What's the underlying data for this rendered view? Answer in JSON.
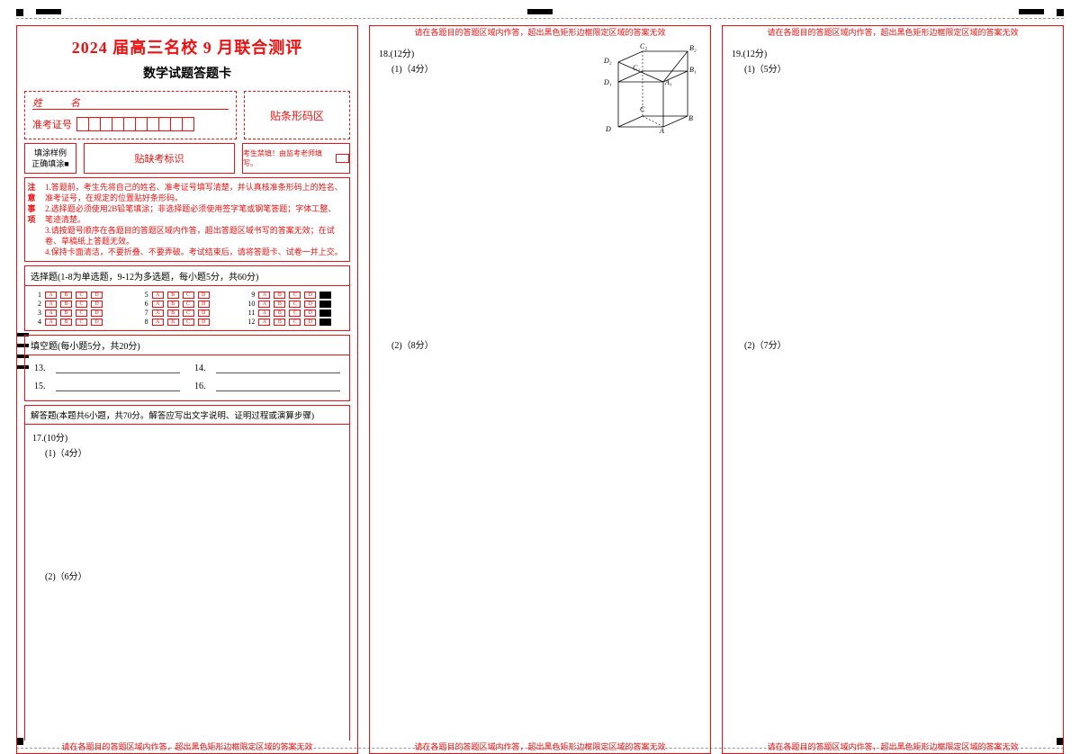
{
  "title": "2024 届高三名校 9 月联合测评",
  "subtitle": "数学试题答题卡",
  "name_label": "姓　名",
  "id_label": "准考证号",
  "barcode_area": "贴条形码区",
  "fill_example_title": "填涂样例",
  "fill_example_sub": "正确填涂■",
  "absent_mark_label": "贴缺考标识",
  "invigilator_sign": "考生禁填！由监考老师填写。",
  "notice_head": [
    "注",
    "意",
    "事",
    "项"
  ],
  "notice_lines": [
    "1.答题前，考生先将自己的姓名、准考证号填写清楚，并认真核准条形码上的姓名、准考证号，在规定的位置贴好条形码。",
    "2.选择题必须使用2B铅笔填涂；非选择题必须使用签字笔或钢笔答题；字体工整、笔迹清楚。",
    "3.请按题号顺序在各题目的答题区域内作答，超出答题区域书写的答案无效；在试卷、草稿纸上答题无效。",
    "4.保持卡面清洁，不要折叠、不要弄破。考试结束后，请将答题卡、试卷一并上交。"
  ],
  "mc_header": "选择题(1-8为单选题，9-12为多选题，每小题5分，共60分)",
  "mc_options": [
    "A",
    "B",
    "C",
    "D"
  ],
  "fillin_header": "填空题(每小题5分，共20分)",
  "fillin_nums": [
    "13.",
    "14.",
    "15.",
    "16."
  ],
  "free_header": "解答题(本题共6小题，共70分。解答应写出文字说明、证明过程或演算步骤)",
  "q17": {
    "hdr": "17.(10分)",
    "p1": "(1)（4分）",
    "p2": "(2)（6分）"
  },
  "warn_text": "请在各题目的答题区域内作答，超出黑色矩形边框限定区域的答案无效",
  "q18": {
    "hdr": "18.(12分)",
    "p1": "(1)（4分）",
    "p2": "(2)（8分）"
  },
  "q19": {
    "hdr": "19.(12分)",
    "p1": "(1)（5分）",
    "p2": "(2)（7分）"
  },
  "prism_labels": {
    "A": "A",
    "B": "B",
    "C": "C",
    "D": "D",
    "A1": "A₁",
    "B1": "B₁",
    "C1": "C₁",
    "D1": "D₁",
    "B2": "B₂",
    "C2": "C₂",
    "D2": "D₂"
  }
}
